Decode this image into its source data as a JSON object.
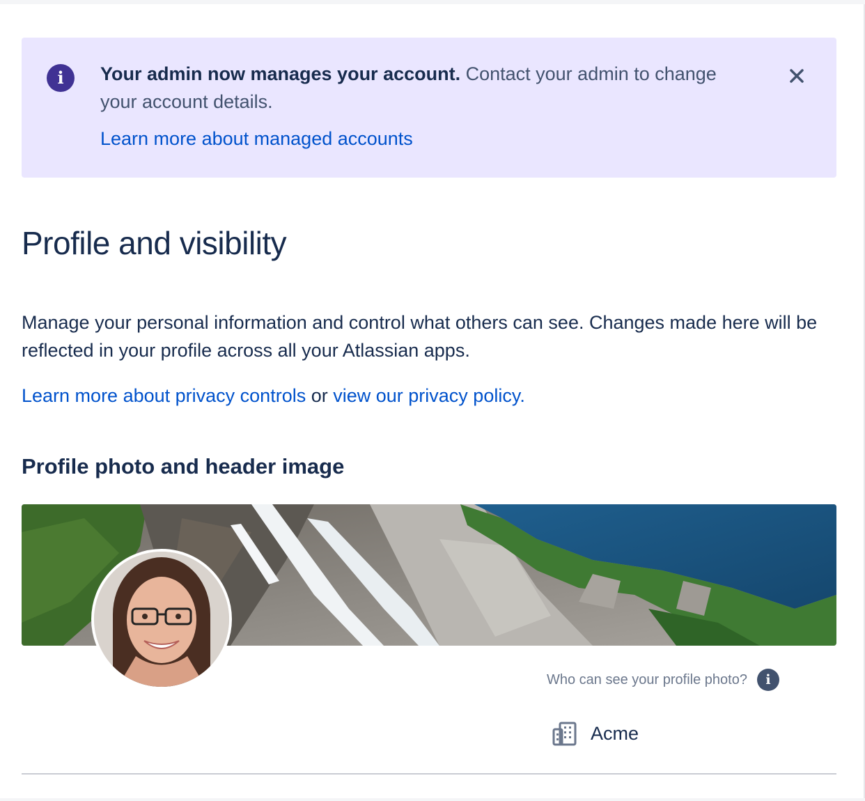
{
  "banner": {
    "bold_text": "Your admin now manages your account.",
    "text": " Contact your admin to change your account details.",
    "link": "Learn more about managed accounts",
    "icon": "info-icon",
    "close_icon": "close-icon",
    "background_color": "#eae6ff",
    "icon_color": "#403294"
  },
  "page": {
    "title": "Profile and visibility",
    "description": "Manage your personal information and control what others can see. Changes made here will be reflected in your profile across all your Atlassian apps.",
    "privacy_link": "Learn more about privacy controls",
    "or_text": " or ",
    "policy_link": "view our privacy policy."
  },
  "profile_section": {
    "heading": "Profile photo and header image",
    "visibility_question": "Who can see your profile photo?",
    "visibility_icon": "info-icon",
    "audience_icon": "office-building-icon",
    "audience": "Acme"
  },
  "colors": {
    "link": "#0052cc",
    "text": "#172b4d"
  }
}
